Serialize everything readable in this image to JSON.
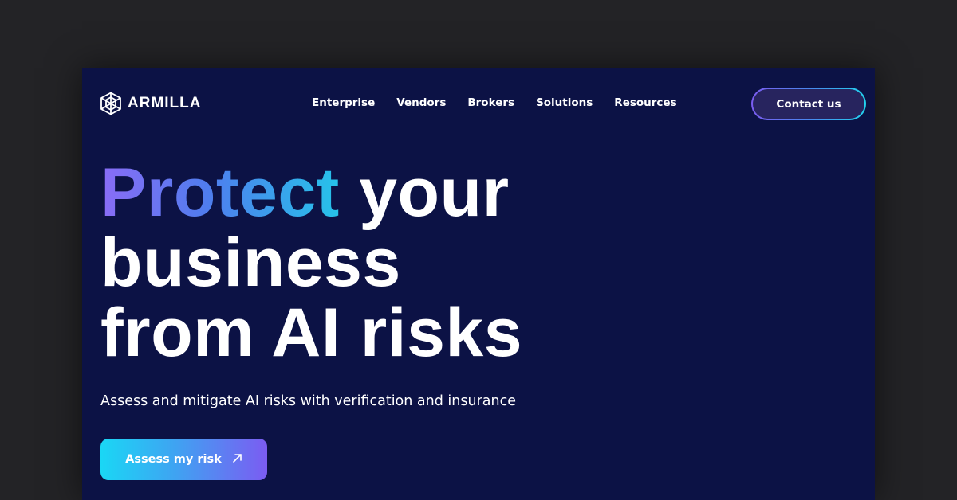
{
  "brand": {
    "name": "ARMILLA",
    "logo_icon": "armilla-logo-icon"
  },
  "nav": {
    "items": [
      {
        "label": "Enterprise"
      },
      {
        "label": "Vendors"
      },
      {
        "label": "Brokers"
      },
      {
        "label": "Solutions"
      },
      {
        "label": "Resources"
      }
    ],
    "contact_label": "Contact us"
  },
  "hero": {
    "title_highlight": "Protect",
    "title_rest_line1": " your",
    "title_line2": "business",
    "title_line3": "from AI risks",
    "subtitle": "Assess and mitigate AI risks with verification and insurance",
    "cta_label": "Assess my risk",
    "cta_icon": "arrow-up-right-icon"
  },
  "colors": {
    "page_background": "#0c1245",
    "backdrop": "#232326",
    "gradient_start": "#8a6cf6",
    "gradient_mid": "#4f7dee",
    "gradient_end": "#26c3ea",
    "cta_start": "#1ad7f5",
    "cta_end": "#7b5cf2",
    "text": "#ffffff"
  }
}
